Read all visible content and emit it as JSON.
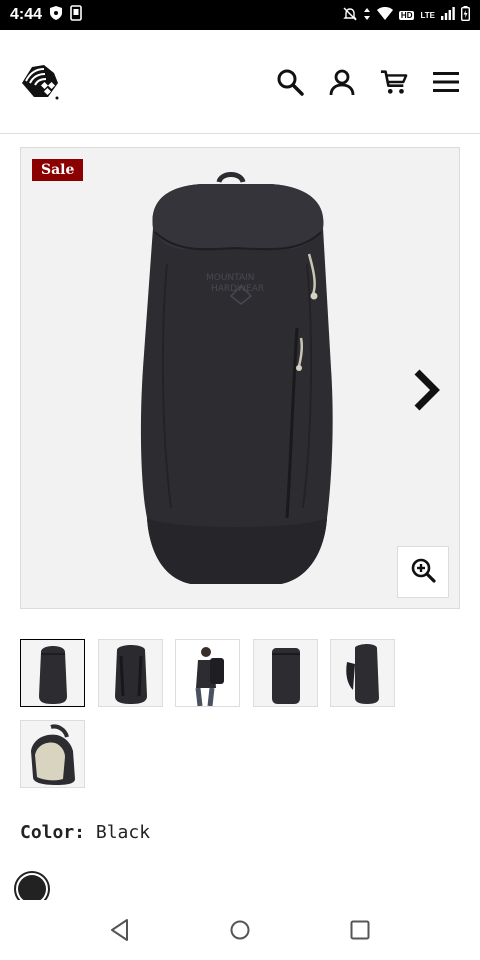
{
  "status_bar": {
    "time": "4:44",
    "network": "LTE",
    "hd": "HD"
  },
  "header": {
    "logo_icon": "mountain-hardwear-logo",
    "icons": [
      "search-icon",
      "account-icon",
      "cart-icon",
      "menu-icon"
    ]
  },
  "gallery": {
    "sale_label": "Sale",
    "product_image": "black-backpack-front",
    "next_icon": "chevron-right-icon",
    "zoom_icon": "zoom-in-icon"
  },
  "thumbnails": [
    {
      "name": "front",
      "active": true
    },
    {
      "name": "back",
      "active": false
    },
    {
      "name": "worn",
      "active": false
    },
    {
      "name": "side",
      "active": false
    },
    {
      "name": "angle",
      "active": false
    },
    {
      "name": "open",
      "active": false
    }
  ],
  "product": {
    "color_label": "Color:",
    "color_value": "Black",
    "swatch_color": "#222222"
  },
  "colors": {
    "sale": "#8b0000",
    "text": "#222222"
  },
  "android_nav": [
    "back-icon",
    "home-icon",
    "recents-icon"
  ]
}
